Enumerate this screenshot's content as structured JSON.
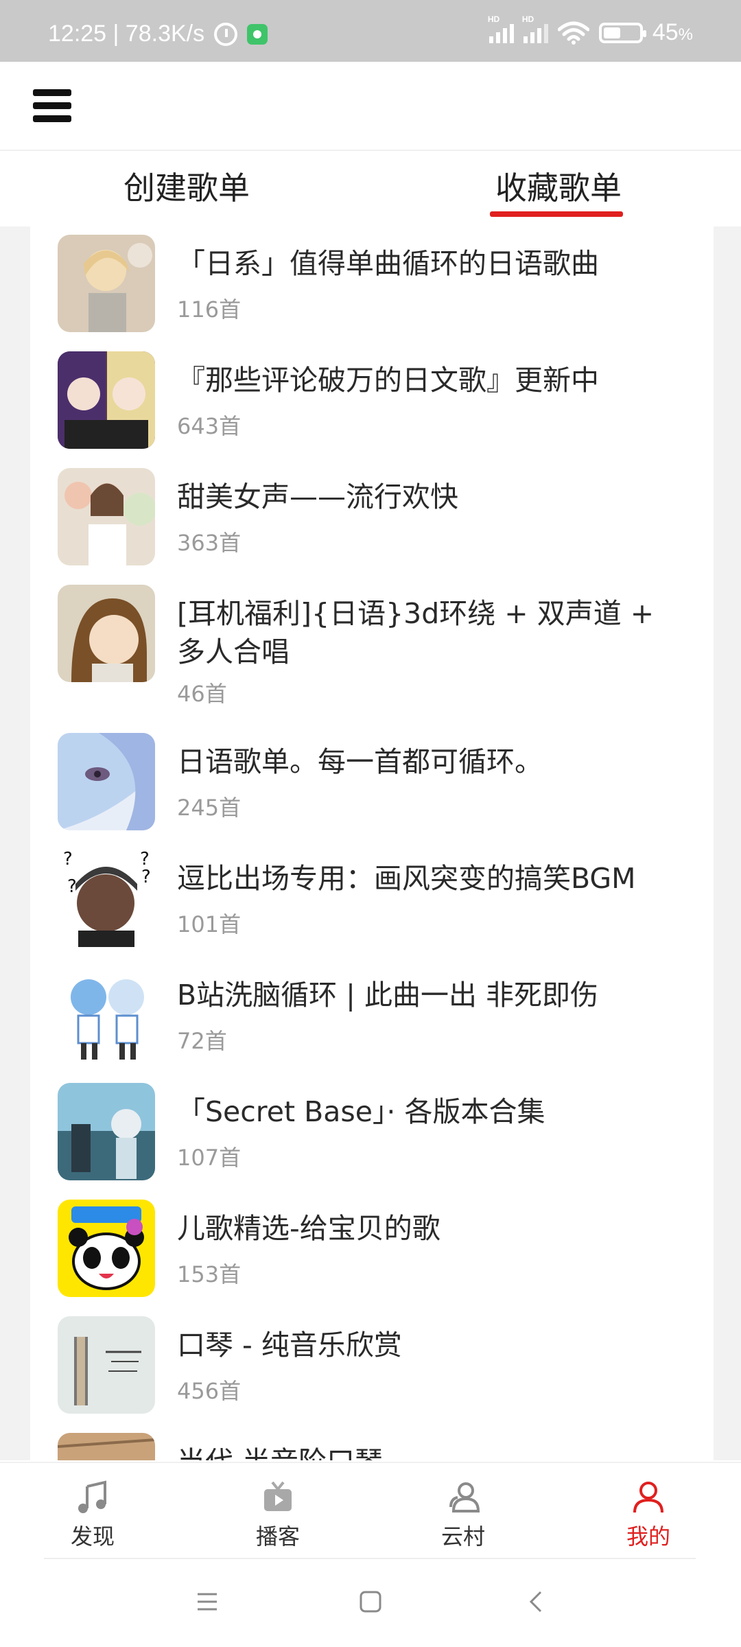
{
  "status_bar": {
    "time_speed": "12:25 | 78.3K/s",
    "signal1_label": "HD",
    "signal2_label": "HD",
    "battery_percent": "45",
    "battery_unit": "%"
  },
  "tabs": {
    "created": "创建歌单",
    "collected": "收藏歌单",
    "active": "collected"
  },
  "playlists": [
    {
      "title": "「日系」值得单曲循环的日语歌曲",
      "count": "116首"
    },
    {
      "title": "『那些评论破万的日文歌』更新中",
      "count": "643首"
    },
    {
      "title": "甜美女声——流行欢快",
      "count": "363首"
    },
    {
      "title": "[耳机福利]{日语}3d环绕 + 双声道 + 多人合唱",
      "count": "46首"
    },
    {
      "title": "日语歌单。每一首都可循环。",
      "count": "245首"
    },
    {
      "title": "逗比出场专用：画风突变的搞笑BGM",
      "count": "101首"
    },
    {
      "title": "B站洗脑循环 | 此曲一出 非死即伤",
      "count": "72首"
    },
    {
      "title": "「Secret Base」· 各版本合集",
      "count": "107首"
    },
    {
      "title": "儿歌精选-给宝贝的歌",
      "count": "153首"
    },
    {
      "title": "口琴 - 纯音乐欣赏",
      "count": "456首"
    },
    {
      "title": "当代 半音阶口琴",
      "count": ""
    }
  ],
  "bottom_nav": [
    {
      "label": "发现",
      "icon": "music-note-icon",
      "active": false
    },
    {
      "label": "播客",
      "icon": "podcast-tv-icon",
      "active": false
    },
    {
      "label": "云村",
      "icon": "community-users-icon",
      "active": false
    },
    {
      "label": "我的",
      "icon": "profile-icon",
      "active": true
    }
  ],
  "colors": {
    "accent": "#e0201f",
    "text": "#2a2a2a",
    "muted": "#9a9a9a",
    "nav_inactive": "#999999"
  }
}
